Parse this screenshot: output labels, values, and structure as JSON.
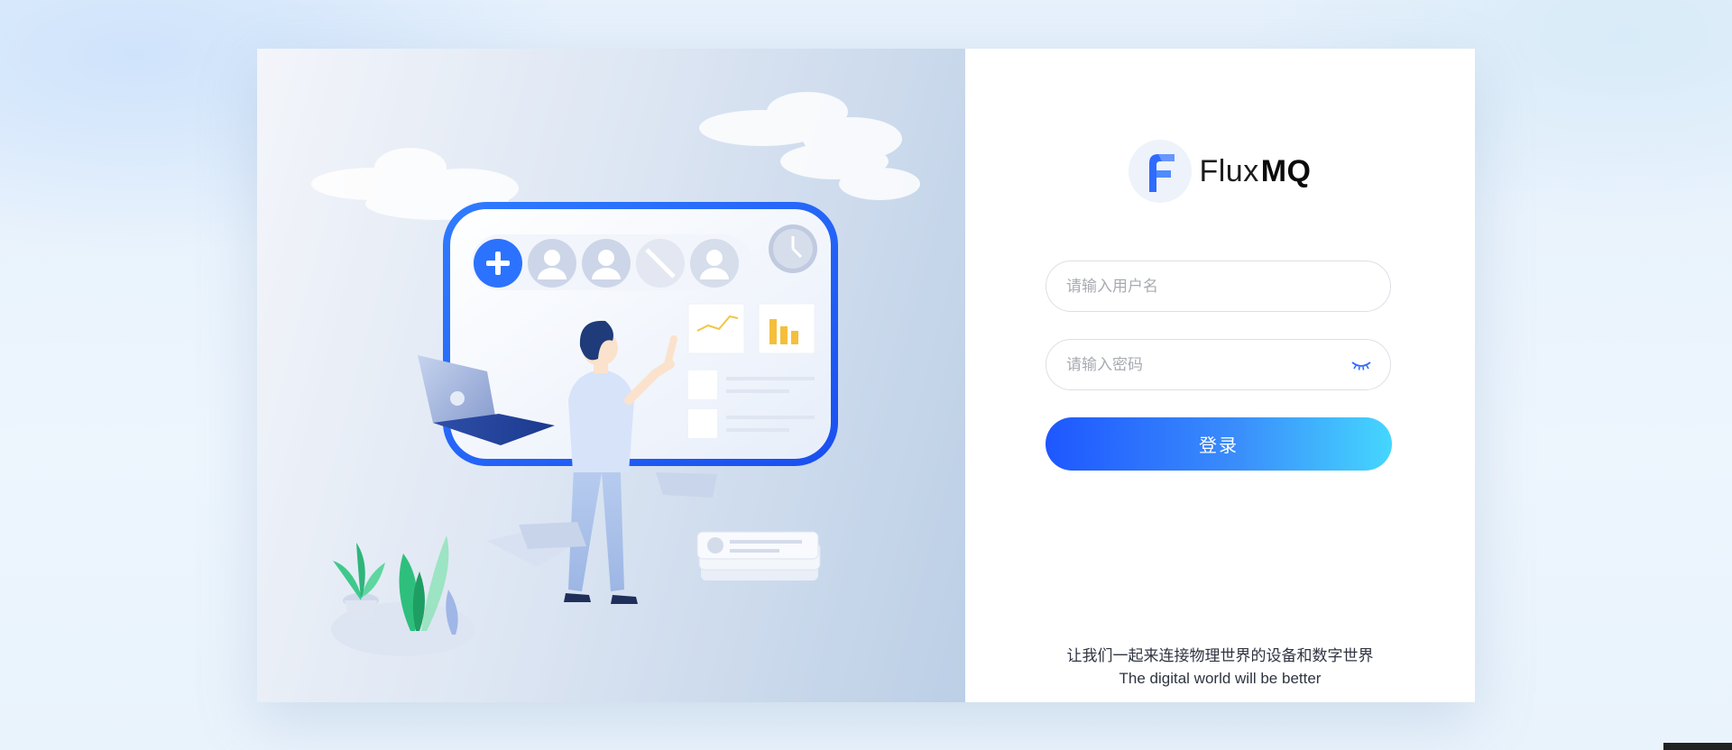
{
  "brand": {
    "name_light": "Flux",
    "name_bold": "MQ",
    "logo_icon": "flux-f-logo-icon"
  },
  "login_form": {
    "username_placeholder": "请输入用户名",
    "password_placeholder": "请输入密码",
    "password_toggle_icon": "eye-closed-icon",
    "submit_label": "登录"
  },
  "slogan": {
    "chinese": "让我们一起来连接物理世界的设备和数字世界",
    "english": "The digital world will be better"
  },
  "colors": {
    "accent_start": "#1e57ff",
    "accent_end": "#45d6fe",
    "brand_blue": "#2f6bff"
  }
}
